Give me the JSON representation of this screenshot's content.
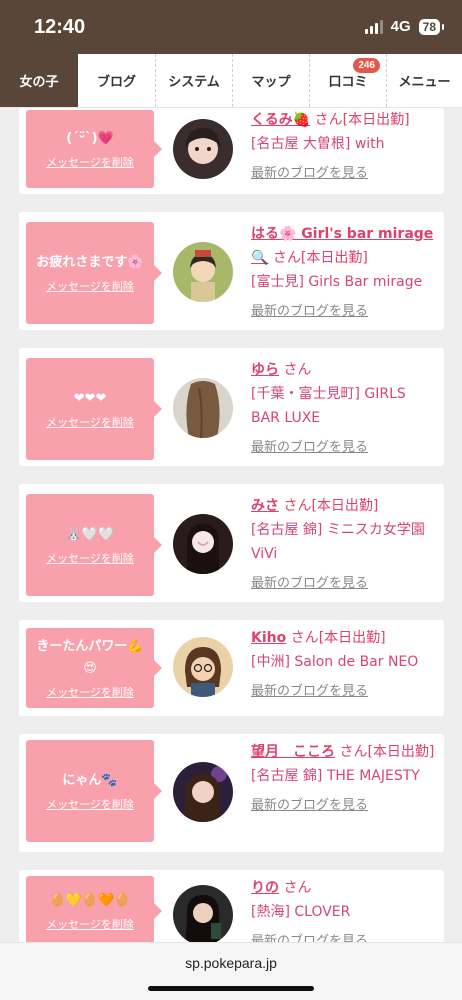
{
  "status": {
    "time": "12:40",
    "network": "4G",
    "battery": "78"
  },
  "tabs": [
    {
      "label": "女の子"
    },
    {
      "label": "ブログ"
    },
    {
      "label": "システム"
    },
    {
      "label": "マップ"
    },
    {
      "label": "口コミ",
      "badge": "246"
    },
    {
      "label": "メニュー"
    }
  ],
  "delete_label": "メッセージを削除",
  "blog_link_label": "最新のブログを見る",
  "san": "さん",
  "cards": [
    {
      "message": "(´ᵕ̈`)💗",
      "name": "くるみ🍓",
      "status": "[本日出勤]",
      "shop": "[名古屋 大曽根] with"
    },
    {
      "message": "お疲れさまです🌸",
      "name": "はる🌸 Girl's bar mirage 🔍",
      "status": "[本日出勤]",
      "shop": "[富士見] Girls Bar mirage"
    },
    {
      "message": "❤❤❤",
      "name": "ゆら",
      "status": "",
      "shop": "[千葉・富士見町] GIRLS BAR LUXE"
    },
    {
      "message": "🐰🤍🤍",
      "name": "みさ",
      "status": "[本日出勤]",
      "shop": "[名古屋 錦] ミニスカ女学園ViVi"
    },
    {
      "message": "きーたんパワー💪😍",
      "name": "Kiho",
      "status": "[本日出勤]",
      "shop": "[中洲] Salon de Bar NEO"
    },
    {
      "message": "にゃん🐾",
      "name": "望月　こころ",
      "status": "[本日出勤]",
      "shop": "[名古屋 錦] THE MAJESTY"
    },
    {
      "message": "🥚💛🥚🧡🥚",
      "name": "りの",
      "status": "",
      "shop": "[熱海] CLOVER"
    }
  ],
  "url": "sp.pokepara.jp",
  "colors": {
    "header": "#5a4638",
    "bubble": "#f8a1ad",
    "accent": "#e0406a",
    "badge": "#e2584b"
  }
}
